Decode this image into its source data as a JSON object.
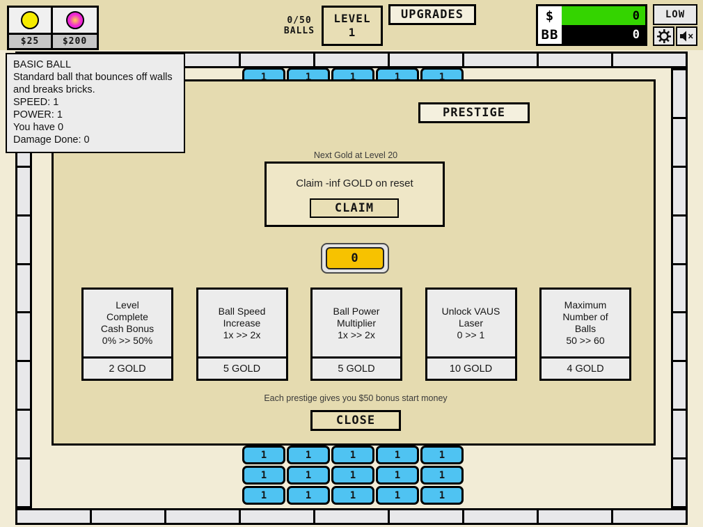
{
  "topbar": {
    "balls_counter": "0/50\nBALLS",
    "level_label": "LEVEL",
    "level_value": "1",
    "upgrades_label": "UPGRADES",
    "low_label": "LOW",
    "gear_icon": "gear-icon",
    "mute_icon": "speaker-muted-icon",
    "ball_shop": {
      "items": [
        {
          "name": "basic-ball",
          "price": "$25",
          "color": "#f6ec00"
        },
        {
          "name": "magenta-ball",
          "price": "$200",
          "color": "#ef26d6"
        }
      ]
    },
    "money": {
      "cash_symbol": "$",
      "cash_value": "0",
      "cash_bar_color": "#34d400",
      "bb_symbol": "BB",
      "bb_value": "0"
    }
  },
  "tooltip": {
    "title": "BASIC BALL",
    "description": "Standard ball that bounces off walls and breaks bricks.",
    "speed": "SPEED: 1",
    "power": "POWER: 1",
    "owned": "You have 0",
    "damage": "Damage Done: 0"
  },
  "playfield": {
    "brick_label": "1",
    "brick_color": "#4fc3f2",
    "top_brick_rows": 1,
    "top_brick_cols": 5,
    "bottom_brick_rows": 3,
    "bottom_brick_cols": 5,
    "wall_segment_color": "#e8e8ea"
  },
  "prestige": {
    "prestige_button": "PRESTIGE",
    "next_gold_label": "Next Gold at Level 20",
    "claim_text": "Claim -inf GOLD on reset",
    "claim_button": "CLAIM",
    "gold_value": "0",
    "gold_color": "#f7c200",
    "note": "Each prestige gives you $50 bonus start money",
    "close_button": "CLOSE",
    "upgrades": [
      {
        "name": "level-complete-cash-bonus",
        "title": "Level\nComplete\nCash Bonus\n0% >> 50%",
        "cost": "2 GOLD"
      },
      {
        "name": "ball-speed-increase",
        "title": "Ball Speed\nIncrease\n1x >> 2x",
        "cost": "5 GOLD"
      },
      {
        "name": "ball-power-multiplier",
        "title": "Ball Power\nMultiplier\n1x >> 2x",
        "cost": "5 GOLD"
      },
      {
        "name": "unlock-vaus-laser",
        "title": "Unlock VAUS\nLaser\n0 >> 1",
        "cost": "10 GOLD"
      },
      {
        "name": "maximum-number-of-balls",
        "title": "Maximum\nNumber of\nBalls\n50 >> 60",
        "cost": "4 GOLD"
      }
    ]
  }
}
